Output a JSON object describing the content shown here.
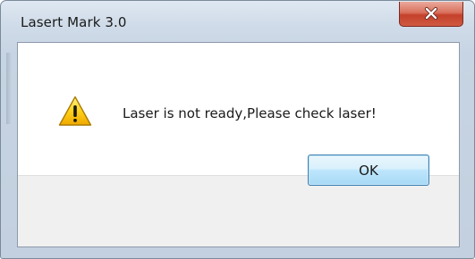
{
  "window": {
    "title": "Lasert Mark 3.0"
  },
  "title_bar": {
    "close_icon": "close-icon"
  },
  "dialog": {
    "icon": "warning-icon",
    "message": "Laser is not ready,Please check laser!",
    "ok_label": "OK"
  },
  "colors": {
    "close_button": "#c4412b",
    "ok_button_border": "#3c7fb1",
    "warning_yellow": "#f5c400"
  }
}
